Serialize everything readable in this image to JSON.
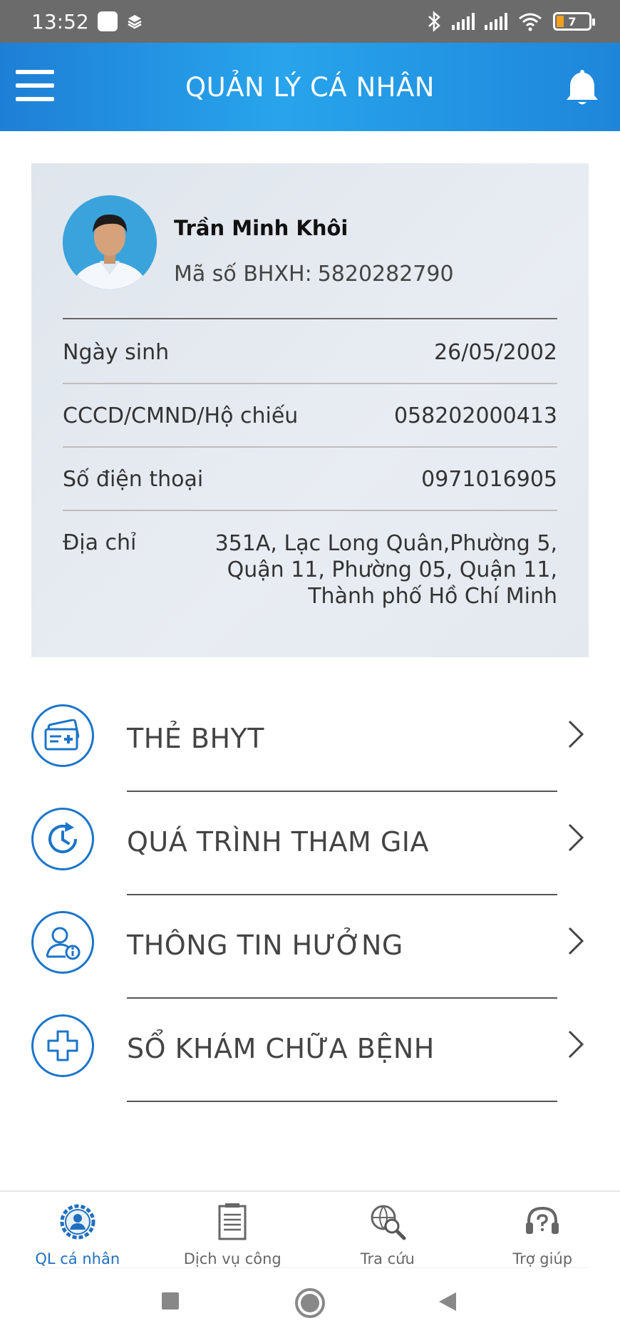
{
  "status_bar": {
    "time": "13:52",
    "battery": "7"
  },
  "header": {
    "title": "QUẢN LÝ CÁ NHÂN"
  },
  "profile": {
    "name": "Trần Minh Khôi",
    "bhxh_label": "Mã số BHXH:",
    "bhxh_value": "5820282790",
    "rows": [
      {
        "label": "Ngày sinh",
        "value": "26/05/2002"
      },
      {
        "label": "CCCD/CMND/Hộ chiếu",
        "value": "058202000413"
      },
      {
        "label": "Số điện thoại",
        "value": "0971016905"
      }
    ],
    "address": {
      "label": "Địa chỉ",
      "lines": [
        "351A, Lạc Long Quân,Phường 5,",
        "Quận 11, Phường 05, Quận 11,",
        "Thành phố Hồ Chí Minh"
      ]
    }
  },
  "menu": [
    {
      "label": "THẺ BHYT",
      "icon": "health-card-icon"
    },
    {
      "label": "QUÁ TRÌNH THAM GIA",
      "icon": "history-clock-icon"
    },
    {
      "label": "THÔNG TIN HƯỞNG",
      "icon": "user-info-icon"
    },
    {
      "label": "SỔ KHÁM CHỮA BỆNH",
      "icon": "medical-cross-icon"
    }
  ],
  "bottom_nav": [
    {
      "label": "QL cá nhân",
      "icon": "profile-gear-icon",
      "active": true
    },
    {
      "label": "Dịch vụ công",
      "icon": "document-icon",
      "active": false
    },
    {
      "label": "Tra cứu",
      "icon": "globe-search-icon",
      "active": false
    },
    {
      "label": "Trợ giúp",
      "icon": "headset-help-icon",
      "active": false
    }
  ],
  "colors": {
    "primary": "#1e86da",
    "icon_blue": "#1b75c9",
    "card_bg": "#e3e9ef"
  }
}
